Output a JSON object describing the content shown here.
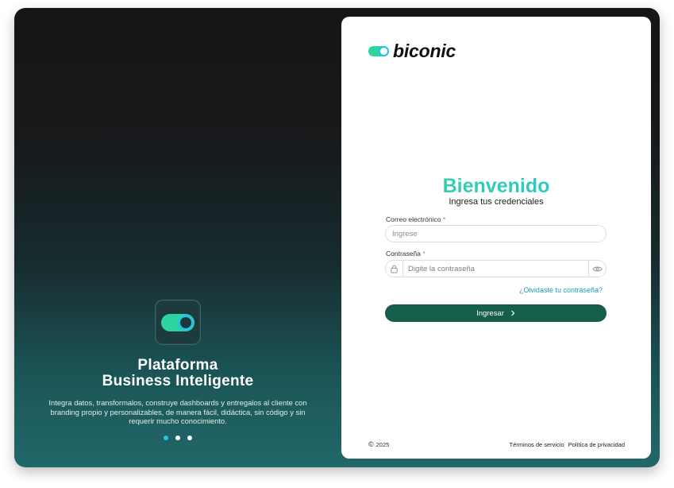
{
  "hero": {
    "title_line1": "Plataforma",
    "title_line2": "Business Inteligente",
    "description": "Integra datos, transformalos, construye dashboards y entregalos al cliente con branding propio y personalizables, de manera fácil, didáctica, sin código y sin requerir mucho conocimiento.",
    "slides_total": 3,
    "slide_active": 1,
    "icon": "toggle-switch-icon"
  },
  "brand": {
    "name": "biconic",
    "logo_icon": "toggle-logo-icon"
  },
  "login": {
    "title": "Bienvenido",
    "subtitle": "Ingresa tus credenciales",
    "email_label": "Correo electrónico",
    "email_placeholder": "Ingrese",
    "email_value": "",
    "password_label": "Contraseña",
    "password_placeholder": "Digite la contraseña",
    "password_value": "",
    "required_marker": "*",
    "forgot_link": "¿Olvidaste tu contraseña?",
    "submit_label": "Ingresar",
    "submit_icon": "chevron-right-icon"
  },
  "footer": {
    "copyright_symbol": "©",
    "year": "2025",
    "terms": "Términos de servicio",
    "privacy": "Política de privacidad"
  },
  "colors": {
    "accent_green": "#2dd4a2",
    "accent_cyan": "#27c3e0",
    "button": "#155e4b",
    "link": "#1f9bb0"
  }
}
